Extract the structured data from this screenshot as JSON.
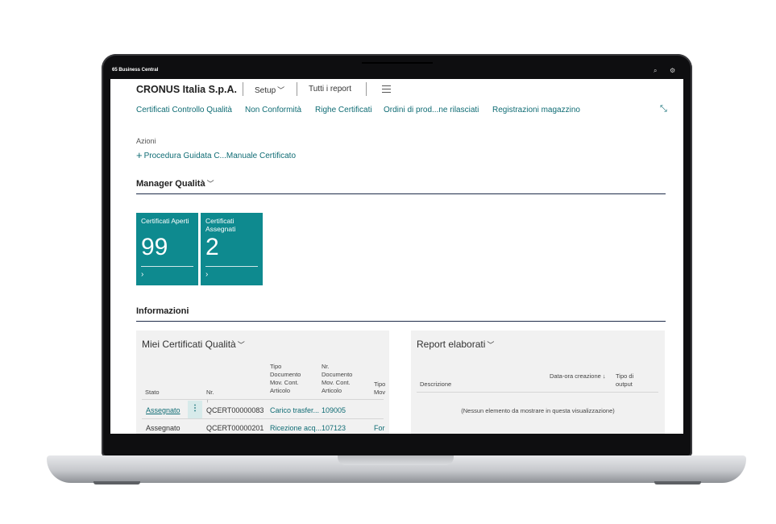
{
  "app": {
    "title": "65 Business Central"
  },
  "header": {
    "company": "CRONUS Italia S.p.A.",
    "menu": [
      "Setup",
      "Tutti i report"
    ]
  },
  "nav": {
    "links": [
      "Certificati Controllo Qualità",
      "Non Conformità",
      "Righe Certificati",
      "Ordini di prod...ne rilasciati",
      "Registrazioni magazzino"
    ]
  },
  "actions": {
    "label": "Azioni",
    "link": "Procedura Guidata C...Manuale Certificato"
  },
  "manager": {
    "title": "Manager Qualità",
    "tiles": [
      {
        "label": "Certificati Aperti",
        "value": "99"
      },
      {
        "label": "Certificati Assegnati",
        "value": "2"
      }
    ]
  },
  "info": {
    "title": "Informazioni"
  },
  "certificates": {
    "title": "Miei Certificati Qualità",
    "columns": [
      "Stato",
      "Nr. ↑",
      "Tipo Documento Mov. Cont. Articolo",
      "Nr. Documento Mov. Cont. Articolo",
      "Tipo Mov"
    ],
    "rows": [
      {
        "stato": "Assegnato",
        "nr": "QCERT00000083",
        "tipo": "Carico trasfer...",
        "nrdoc": "109005"
      },
      {
        "stato": "Assegnato",
        "nr": "QCERT00000201",
        "tipo": "Ricezione acq...",
        "nrdoc": "107123",
        "tipomov": "For"
      }
    ]
  },
  "reports": {
    "title": "Report elaborati",
    "columns": [
      "Descrizione",
      "Data-ora creazione ↓",
      "Tipo di output"
    ],
    "empty": "(Nessun elemento da mostrare in questa visualizzazione)"
  },
  "colors": {
    "accent": "#0f6c74",
    "tile": "#0e8a8f"
  }
}
